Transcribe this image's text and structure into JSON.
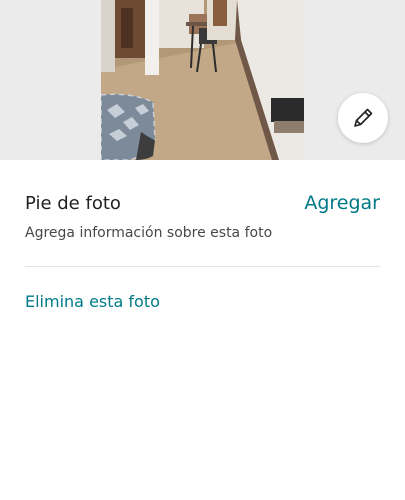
{
  "photo": {
    "description_icon": "room-photo",
    "edit_icon": "pencil-icon"
  },
  "caption": {
    "title": "Pie de foto",
    "add_label": "Agregar",
    "subtitle": "Agrega información sobre esta foto"
  },
  "actions": {
    "delete_label": "Elimina esta foto"
  },
  "colors": {
    "accent": "#007a87",
    "text": "#222222",
    "photo_background": "#ebebeb"
  }
}
